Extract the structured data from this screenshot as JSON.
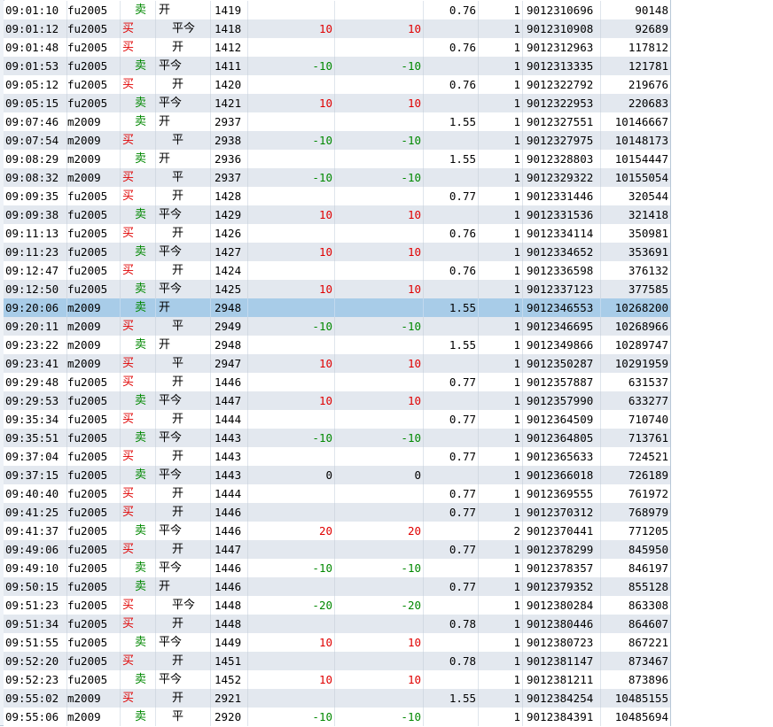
{
  "colors": {
    "buy": "#e00000",
    "sell": "#008800",
    "row_alt": "#e3e8ef",
    "selected_row": "#a8cce8"
  },
  "selected_index": 16,
  "rows": [
    {
      "time": "09:01:10",
      "code": "fu2005",
      "side": "卖",
      "open": "开",
      "price": "1419",
      "pnl1": "",
      "pnl2": "",
      "fee": "0.76",
      "qty": "1",
      "order": "9012310696",
      "seq": "90148"
    },
    {
      "time": "09:01:12",
      "code": "fu2005",
      "side": "买",
      "open": "平今",
      "price": "1418",
      "pnl1": "10",
      "pnl2": "10",
      "fee": "",
      "qty": "1",
      "order": "9012310908",
      "seq": "92689"
    },
    {
      "time": "09:01:48",
      "code": "fu2005",
      "side": "买",
      "open": "开",
      "price": "1412",
      "pnl1": "",
      "pnl2": "",
      "fee": "0.76",
      "qty": "1",
      "order": "9012312963",
      "seq": "117812"
    },
    {
      "time": "09:01:53",
      "code": "fu2005",
      "side": "卖",
      "open": "平今",
      "price": "1411",
      "pnl1": "-10",
      "pnl2": "-10",
      "fee": "",
      "qty": "1",
      "order": "9012313335",
      "seq": "121781"
    },
    {
      "time": "09:05:12",
      "code": "fu2005",
      "side": "买",
      "open": "开",
      "price": "1420",
      "pnl1": "",
      "pnl2": "",
      "fee": "0.76",
      "qty": "1",
      "order": "9012322792",
      "seq": "219676"
    },
    {
      "time": "09:05:15",
      "code": "fu2005",
      "side": "卖",
      "open": "平今",
      "price": "1421",
      "pnl1": "10",
      "pnl2": "10",
      "fee": "",
      "qty": "1",
      "order": "9012322953",
      "seq": "220683"
    },
    {
      "time": "09:07:46",
      "code": "m2009",
      "side": "卖",
      "open": "开",
      "price": "2937",
      "pnl1": "",
      "pnl2": "",
      "fee": "1.55",
      "qty": "1",
      "order": "9012327551",
      "seq": "10146667"
    },
    {
      "time": "09:07:54",
      "code": "m2009",
      "side": "买",
      "open": "平",
      "price": "2938",
      "pnl1": "-10",
      "pnl2": "-10",
      "fee": "",
      "qty": "1",
      "order": "9012327975",
      "seq": "10148173"
    },
    {
      "time": "09:08:29",
      "code": "m2009",
      "side": "卖",
      "open": "开",
      "price": "2936",
      "pnl1": "",
      "pnl2": "",
      "fee": "1.55",
      "qty": "1",
      "order": "9012328803",
      "seq": "10154447"
    },
    {
      "time": "09:08:32",
      "code": "m2009",
      "side": "买",
      "open": "平",
      "price": "2937",
      "pnl1": "-10",
      "pnl2": "-10",
      "fee": "",
      "qty": "1",
      "order": "9012329322",
      "seq": "10155054"
    },
    {
      "time": "09:09:35",
      "code": "fu2005",
      "side": "买",
      "open": "开",
      "price": "1428",
      "pnl1": "",
      "pnl2": "",
      "fee": "0.77",
      "qty": "1",
      "order": "9012331446",
      "seq": "320544"
    },
    {
      "time": "09:09:38",
      "code": "fu2005",
      "side": "卖",
      "open": "平今",
      "price": "1429",
      "pnl1": "10",
      "pnl2": "10",
      "fee": "",
      "qty": "1",
      "order": "9012331536",
      "seq": "321418"
    },
    {
      "time": "09:11:13",
      "code": "fu2005",
      "side": "买",
      "open": "开",
      "price": "1426",
      "pnl1": "",
      "pnl2": "",
      "fee": "0.76",
      "qty": "1",
      "order": "9012334114",
      "seq": "350981"
    },
    {
      "time": "09:11:23",
      "code": "fu2005",
      "side": "卖",
      "open": "平今",
      "price": "1427",
      "pnl1": "10",
      "pnl2": "10",
      "fee": "",
      "qty": "1",
      "order": "9012334652",
      "seq": "353691"
    },
    {
      "time": "09:12:47",
      "code": "fu2005",
      "side": "买",
      "open": "开",
      "price": "1424",
      "pnl1": "",
      "pnl2": "",
      "fee": "0.76",
      "qty": "1",
      "order": "9012336598",
      "seq": "376132"
    },
    {
      "time": "09:12:50",
      "code": "fu2005",
      "side": "卖",
      "open": "平今",
      "price": "1425",
      "pnl1": "10",
      "pnl2": "10",
      "fee": "",
      "qty": "1",
      "order": "9012337123",
      "seq": "377585"
    },
    {
      "time": "09:20:06",
      "code": "m2009",
      "side": "卖",
      "open": "开",
      "price": "2948",
      "pnl1": "",
      "pnl2": "",
      "fee": "1.55",
      "qty": "1",
      "order": "9012346553",
      "seq": "10268200"
    },
    {
      "time": "09:20:11",
      "code": "m2009",
      "side": "买",
      "open": "平",
      "price": "2949",
      "pnl1": "-10",
      "pnl2": "-10",
      "fee": "",
      "qty": "1",
      "order": "9012346695",
      "seq": "10268966"
    },
    {
      "time": "09:23:22",
      "code": "m2009",
      "side": "卖",
      "open": "开",
      "price": "2948",
      "pnl1": "",
      "pnl2": "",
      "fee": "1.55",
      "qty": "1",
      "order": "9012349866",
      "seq": "10289747"
    },
    {
      "time": "09:23:41",
      "code": "m2009",
      "side": "买",
      "open": "平",
      "price": "2947",
      "pnl1": "10",
      "pnl2": "10",
      "fee": "",
      "qty": "1",
      "order": "9012350287",
      "seq": "10291959"
    },
    {
      "time": "09:29:48",
      "code": "fu2005",
      "side": "买",
      "open": "开",
      "price": "1446",
      "pnl1": "",
      "pnl2": "",
      "fee": "0.77",
      "qty": "1",
      "order": "9012357887",
      "seq": "631537"
    },
    {
      "time": "09:29:53",
      "code": "fu2005",
      "side": "卖",
      "open": "平今",
      "price": "1447",
      "pnl1": "10",
      "pnl2": "10",
      "fee": "",
      "qty": "1",
      "order": "9012357990",
      "seq": "633277"
    },
    {
      "time": "09:35:34",
      "code": "fu2005",
      "side": "买",
      "open": "开",
      "price": "1444",
      "pnl1": "",
      "pnl2": "",
      "fee": "0.77",
      "qty": "1",
      "order": "9012364509",
      "seq": "710740"
    },
    {
      "time": "09:35:51",
      "code": "fu2005",
      "side": "卖",
      "open": "平今",
      "price": "1443",
      "pnl1": "-10",
      "pnl2": "-10",
      "fee": "",
      "qty": "1",
      "order": "9012364805",
      "seq": "713761"
    },
    {
      "time": "09:37:04",
      "code": "fu2005",
      "side": "买",
      "open": "开",
      "price": "1443",
      "pnl1": "",
      "pnl2": "",
      "fee": "0.77",
      "qty": "1",
      "order": "9012365633",
      "seq": "724521"
    },
    {
      "time": "09:37:15",
      "code": "fu2005",
      "side": "卖",
      "open": "平今",
      "price": "1443",
      "pnl1": "0",
      "pnl2": "0",
      "fee": "",
      "qty": "1",
      "order": "9012366018",
      "seq": "726189"
    },
    {
      "time": "09:40:40",
      "code": "fu2005",
      "side": "买",
      "open": "开",
      "price": "1444",
      "pnl1": "",
      "pnl2": "",
      "fee": "0.77",
      "qty": "1",
      "order": "9012369555",
      "seq": "761972"
    },
    {
      "time": "09:41:25",
      "code": "fu2005",
      "side": "买",
      "open": "开",
      "price": "1446",
      "pnl1": "",
      "pnl2": "",
      "fee": "0.77",
      "qty": "1",
      "order": "9012370312",
      "seq": "768979"
    },
    {
      "time": "09:41:37",
      "code": "fu2005",
      "side": "卖",
      "open": "平今",
      "price": "1446",
      "pnl1": "20",
      "pnl2": "20",
      "fee": "",
      "qty": "2",
      "order": "9012370441",
      "seq": "771205"
    },
    {
      "time": "09:49:06",
      "code": "fu2005",
      "side": "买",
      "open": "开",
      "price": "1447",
      "pnl1": "",
      "pnl2": "",
      "fee": "0.77",
      "qty": "1",
      "order": "9012378299",
      "seq": "845950"
    },
    {
      "time": "09:49:10",
      "code": "fu2005",
      "side": "卖",
      "open": "平今",
      "price": "1446",
      "pnl1": "-10",
      "pnl2": "-10",
      "fee": "",
      "qty": "1",
      "order": "9012378357",
      "seq": "846197"
    },
    {
      "time": "09:50:15",
      "code": "fu2005",
      "side": "卖",
      "open": "开",
      "price": "1446",
      "pnl1": "",
      "pnl2": "",
      "fee": "0.77",
      "qty": "1",
      "order": "9012379352",
      "seq": "855128"
    },
    {
      "time": "09:51:23",
      "code": "fu2005",
      "side": "买",
      "open": "平今",
      "price": "1448",
      "pnl1": "-20",
      "pnl2": "-20",
      "fee": "",
      "qty": "1",
      "order": "9012380284",
      "seq": "863308"
    },
    {
      "time": "09:51:34",
      "code": "fu2005",
      "side": "买",
      "open": "开",
      "price": "1448",
      "pnl1": "",
      "pnl2": "",
      "fee": "0.78",
      "qty": "1",
      "order": "9012380446",
      "seq": "864607"
    },
    {
      "time": "09:51:55",
      "code": "fu2005",
      "side": "卖",
      "open": "平今",
      "price": "1449",
      "pnl1": "10",
      "pnl2": "10",
      "fee": "",
      "qty": "1",
      "order": "9012380723",
      "seq": "867221"
    },
    {
      "time": "09:52:20",
      "code": "fu2005",
      "side": "买",
      "open": "开",
      "price": "1451",
      "pnl1": "",
      "pnl2": "",
      "fee": "0.78",
      "qty": "1",
      "order": "9012381147",
      "seq": "873467"
    },
    {
      "time": "09:52:23",
      "code": "fu2005",
      "side": "卖",
      "open": "平今",
      "price": "1452",
      "pnl1": "10",
      "pnl2": "10",
      "fee": "",
      "qty": "1",
      "order": "9012381211",
      "seq": "873896"
    },
    {
      "time": "09:55:02",
      "code": "m2009",
      "side": "买",
      "open": "开",
      "price": "2921",
      "pnl1": "",
      "pnl2": "",
      "fee": "1.55",
      "qty": "1",
      "order": "9012384254",
      "seq": "10485155"
    },
    {
      "time": "09:55:06",
      "code": "m2009",
      "side": "卖",
      "open": "平",
      "price": "2920",
      "pnl1": "-10",
      "pnl2": "-10",
      "fee": "",
      "qty": "1",
      "order": "9012384391",
      "seq": "10485694"
    }
  ]
}
